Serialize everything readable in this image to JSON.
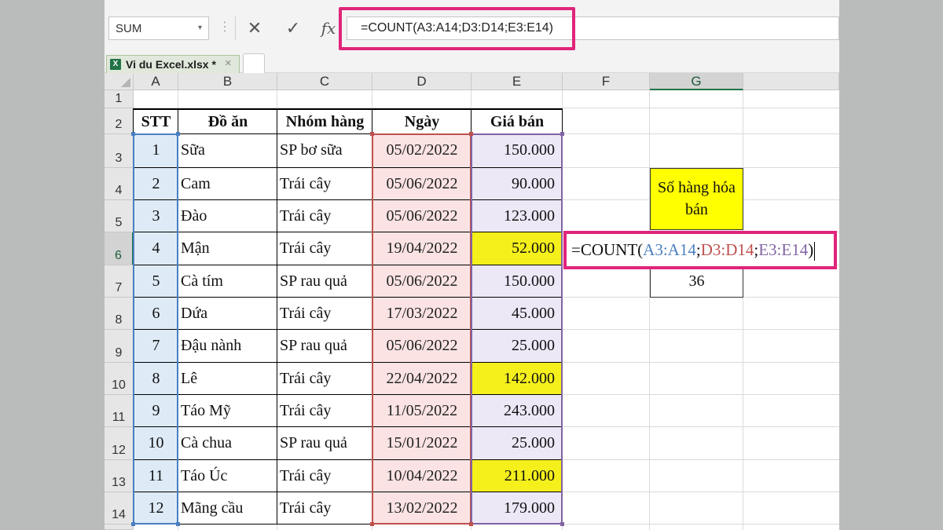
{
  "formula_bar": {
    "name_box": "SUM",
    "name_box_arrow": "▾",
    "dots": "⋮",
    "cancel_icon": "✕",
    "enter_icon": "✓",
    "fx_label": "fx",
    "formula": "=COUNT(A3:A14;D3:D14;E3:E14)"
  },
  "workbook_tab": {
    "name": "Vi du Excel.xlsx *",
    "icon_label": "X",
    "close": "×"
  },
  "columns": [
    "A",
    "B",
    "C",
    "D",
    "E",
    "F",
    "G"
  ],
  "selected_column": "G",
  "rows": [
    "1",
    "2",
    "3",
    "4",
    "5",
    "6",
    "7",
    "8",
    "9",
    "10",
    "11",
    "12",
    "13",
    "14"
  ],
  "selected_row": "6",
  "table": {
    "headers": [
      "STT",
      "Đồ ăn",
      "Nhóm hàng",
      "Ngày",
      "Giá bán"
    ],
    "rows": [
      [
        "1",
        "Sữa",
        "SP bơ sữa",
        "05/02/2022",
        "150.000"
      ],
      [
        "2",
        "Cam",
        "Trái cây",
        "05/06/2022",
        "90.000"
      ],
      [
        "3",
        "Đào",
        "Trái cây",
        "05/06/2022",
        "123.000"
      ],
      [
        "4",
        "Mận",
        "Trái cây",
        "19/04/2022",
        "52.000"
      ],
      [
        "5",
        "Cà tím",
        "SP rau quả",
        "05/06/2022",
        "150.000"
      ],
      [
        "6",
        "Dứa",
        "Trái cây",
        "17/03/2022",
        "45.000"
      ],
      [
        "7",
        "Đậu nành",
        "SP rau quả",
        "05/06/2022",
        "25.000"
      ],
      [
        "8",
        "Lê",
        "Trái cây",
        "22/04/2022",
        "142.000"
      ],
      [
        "9",
        "Táo Mỹ",
        "Trái cây",
        "11/05/2022",
        "243.000"
      ],
      [
        "10",
        "Cà chua",
        "SP rau quả",
        "15/01/2022",
        "25.000"
      ],
      [
        "11",
        "Táo Úc",
        "Trái cây",
        "10/04/2022",
        "211.000"
      ],
      [
        "12",
        "Mãng cầu",
        "Trái cây",
        "13/02/2022",
        "179.000"
      ]
    ]
  },
  "summary": {
    "label_line1": "Số hàng hóa",
    "label_line2": "bán",
    "editing_formula": {
      "prefix": "=COUNT(",
      "ref_a": "A3:A14",
      "sep1": ";",
      "ref_d": "D3:D14",
      "sep2": ";",
      "ref_e": "E3:E14",
      "suffix": ")"
    },
    "result": "36"
  },
  "colors": {
    "highlight_border": "#e0257a",
    "ref_a": "#4a7fc1",
    "ref_d": "#c0504d",
    "ref_e": "#8064a2",
    "yellow_fill": "#f5f01c",
    "excel_green": "#217346"
  }
}
